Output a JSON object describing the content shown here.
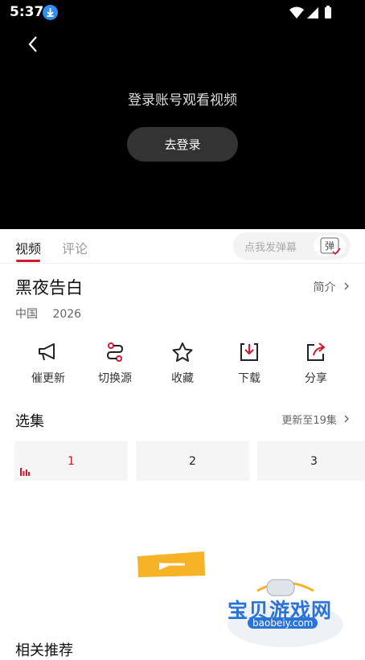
{
  "status_bar": {
    "time": "5:37"
  },
  "player": {
    "login_prompt": "登录账号观看视频",
    "login_button": "去登录"
  },
  "tabs": [
    {
      "label": "视频"
    },
    {
      "label": "评论"
    }
  ],
  "danmaku": {
    "placeholder": "点我发弹幕",
    "badge": "弹"
  },
  "show": {
    "title": "黑夜告白",
    "intro_link": "简介",
    "region": "中国",
    "year": "2026"
  },
  "actions": [
    {
      "label": "催更新",
      "icon": "megaphone-icon"
    },
    {
      "label": "切换源",
      "icon": "route-switch-icon"
    },
    {
      "label": "收藏",
      "icon": "star-icon"
    },
    {
      "label": "下载",
      "icon": "download-icon"
    },
    {
      "label": "分享",
      "icon": "share-icon"
    }
  ],
  "episodes": {
    "section_title": "选集",
    "update_text": "更新至19集",
    "items": [
      {
        "label": "1"
      },
      {
        "label": "2"
      },
      {
        "label": "3"
      }
    ]
  },
  "watermark": {
    "name": "宝贝游戏网",
    "url": "baobeiy.com"
  },
  "next_section_partial": "相关推荐",
  "colors": {
    "accent": "#d0182f",
    "player_bg": "#000000"
  }
}
